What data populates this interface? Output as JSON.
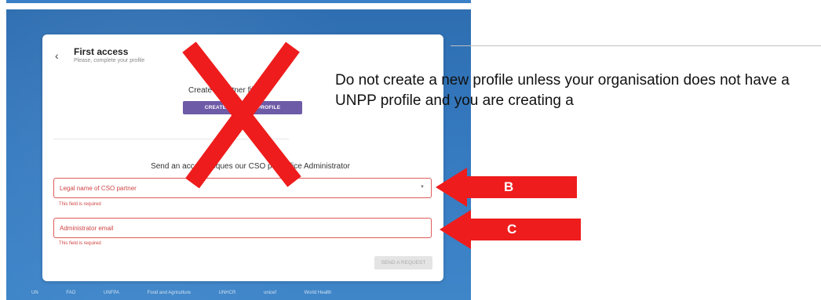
{
  "header": {
    "title": "First access",
    "subtitle": "Please, complete your profile"
  },
  "create_profile": {
    "label": "Create a      partner      file",
    "button_label": "CREATE A NEW C      P      PROFILE"
  },
  "request": {
    "label": "Send an access reques      our CSO partn      ffice Administrator",
    "legal_name_label": "Legal name of CSO partner",
    "legal_name_helper": "This field is required",
    "admin_email_label": "Administrator email",
    "admin_email_helper": "This field is required",
    "send_button_label": "SEND A REQUEST"
  },
  "annotation": {
    "instruction_text": "Do not create a new profile unless your organisation does not have a UNPP profile and you are creating a",
    "arrow_b_label": "B",
    "arrow_c_label": "C",
    "cross_mark_color": "#ee1c1c",
    "arrow_color": "#ee1c1c"
  },
  "footer": {
    "logos": [
      "UN",
      "FAO",
      "UNFPA",
      "Food and Agriculture",
      "UNHCR",
      "unicef",
      "World Health"
    ]
  },
  "colors": {
    "background_blue": "#3579bf",
    "primary_button": "#6e5ba7",
    "error": "#d04545"
  }
}
